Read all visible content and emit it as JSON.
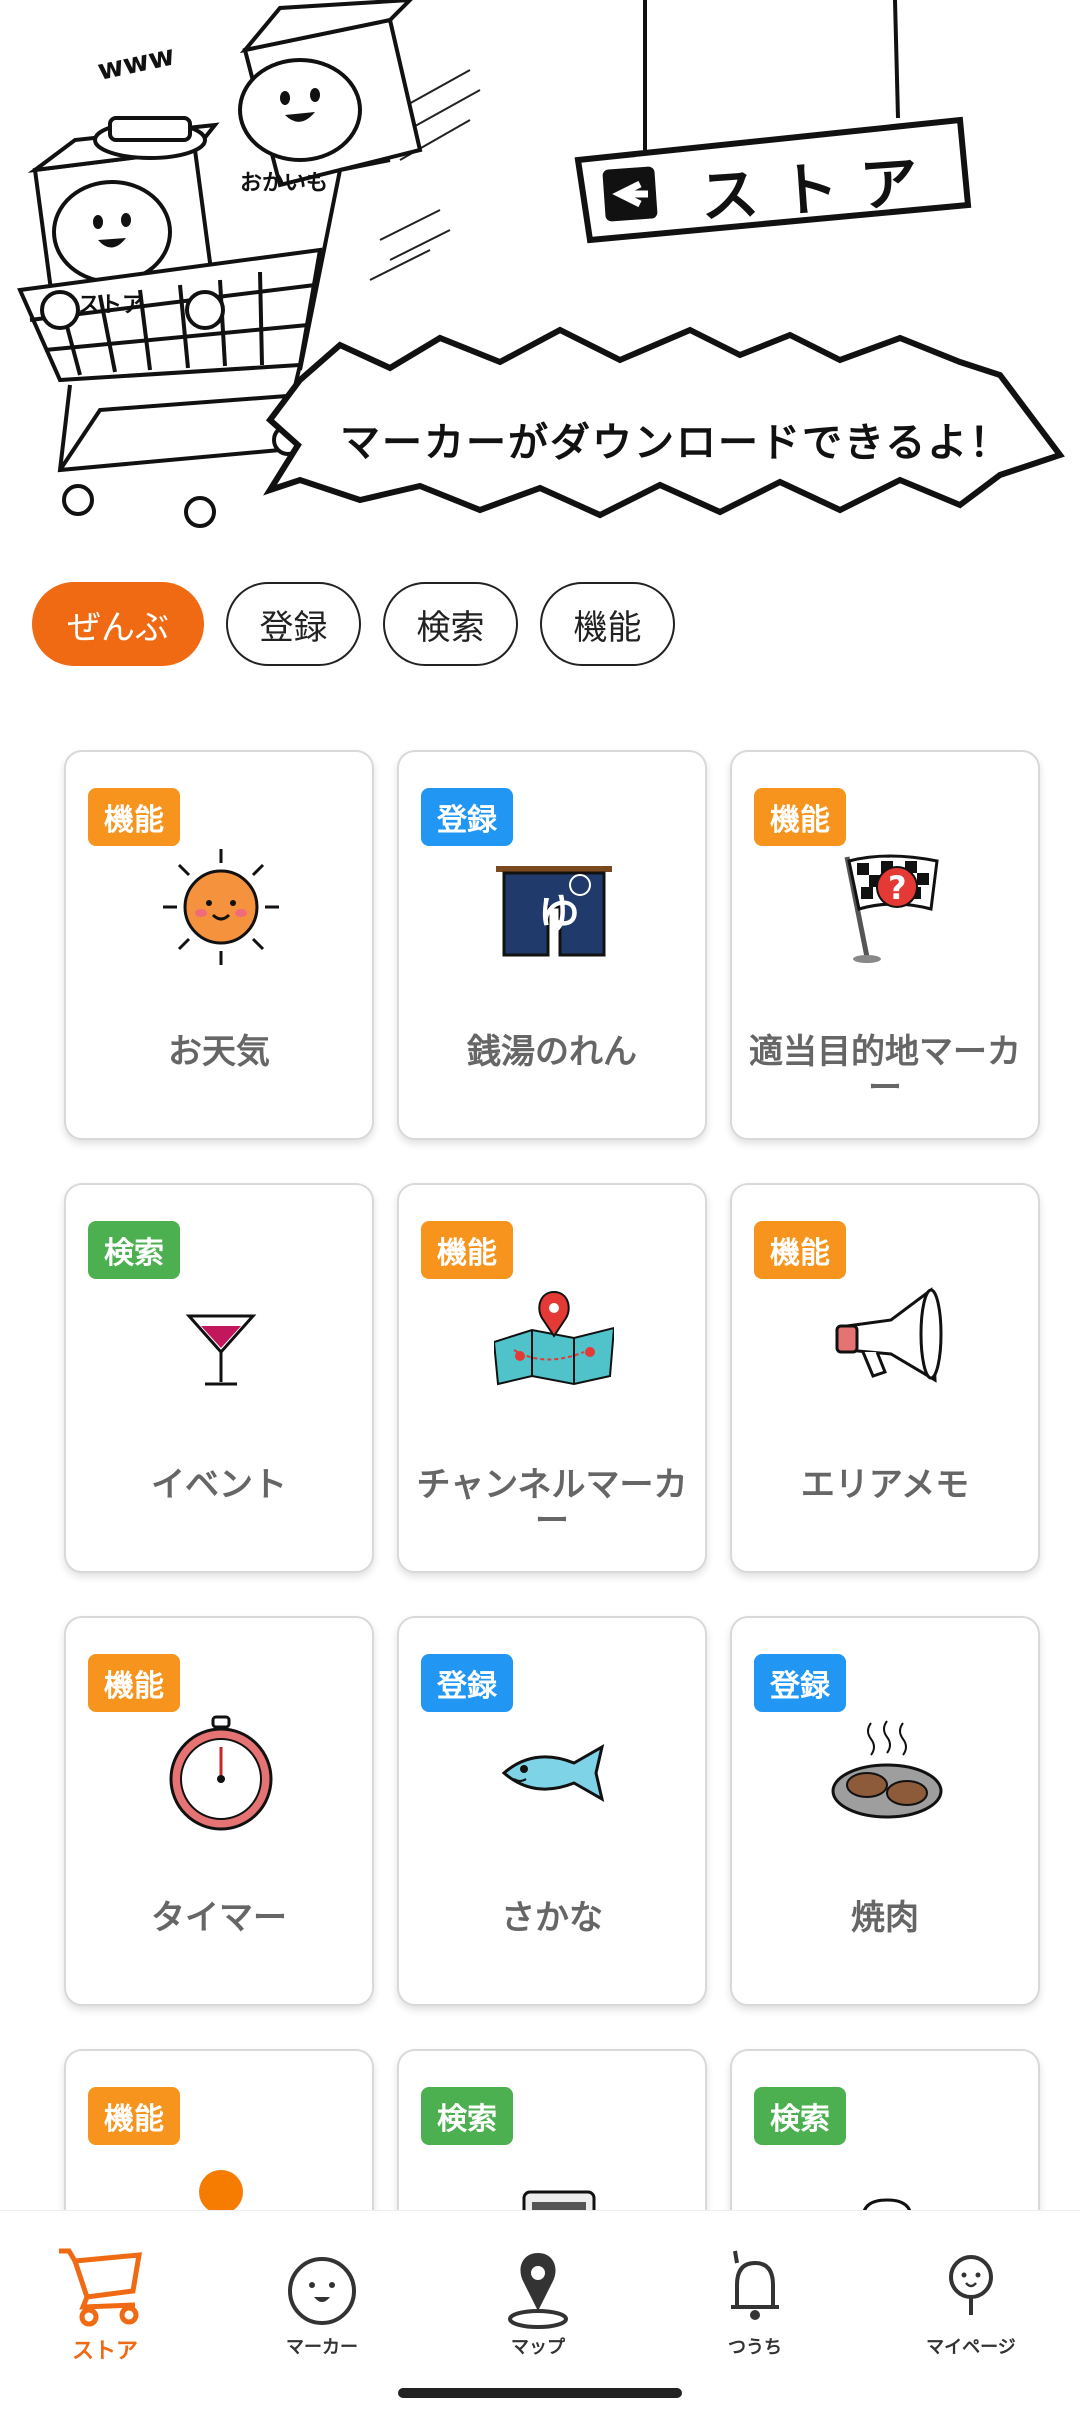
{
  "hero": {
    "sign_text": "ストア",
    "bubble_text": "マーカーがダウンロードできるよ！",
    "cart_labels": [
      "ストア",
      "おかいも",
      "www"
    ]
  },
  "filters": [
    {
      "label": "ぜんぶ",
      "active": true
    },
    {
      "label": "登録",
      "active": false
    },
    {
      "label": "検索",
      "active": false
    },
    {
      "label": "機能",
      "active": false
    }
  ],
  "items": [
    {
      "tag": "機能",
      "tag_type": "func",
      "title": "お天気",
      "icon": "sun-icon"
    },
    {
      "tag": "登録",
      "tag_type": "reg",
      "title": "銭湯のれん",
      "icon": "noren-icon"
    },
    {
      "tag": "機能",
      "tag_type": "func",
      "title": "適当目的地マーカー",
      "icon": "flag-icon"
    },
    {
      "tag": "検索",
      "tag_type": "search",
      "title": "イベント",
      "icon": "cocktail-icon"
    },
    {
      "tag": "機能",
      "tag_type": "func",
      "title": "チャンネルマーカー",
      "icon": "map-icon"
    },
    {
      "tag": "機能",
      "tag_type": "func",
      "title": "エリアメモ",
      "icon": "megaphone-icon"
    },
    {
      "tag": "機能",
      "tag_type": "func",
      "title": "タイマー",
      "icon": "stopwatch-icon"
    },
    {
      "tag": "登録",
      "tag_type": "reg",
      "title": "さかな",
      "icon": "fish-icon"
    },
    {
      "tag": "登録",
      "tag_type": "reg",
      "title": "焼肉",
      "icon": "yakiniku-icon"
    },
    {
      "tag": "機能",
      "tag_type": "func",
      "title": "",
      "icon": "person-icon"
    },
    {
      "tag": "検索",
      "tag_type": "search",
      "title": "",
      "icon": "book-icon"
    },
    {
      "tag": "検索",
      "tag_type": "search",
      "title": "",
      "icon": "beer-icon"
    }
  ],
  "nav": [
    {
      "label": "ストア",
      "icon": "cart-icon",
      "active": true
    },
    {
      "label": "マーカー",
      "icon": "marker-face-icon",
      "active": false
    },
    {
      "label": "マップ",
      "icon": "map-pin-icon",
      "active": false
    },
    {
      "label": "つうち",
      "icon": "bell-icon",
      "active": false
    },
    {
      "label": "マイページ",
      "icon": "mypage-icon",
      "active": false
    }
  ],
  "colors": {
    "accent": "#ef6a12",
    "tag_func": "#f7941d",
    "tag_reg": "#2196f3",
    "tag_search": "#4caf50"
  }
}
